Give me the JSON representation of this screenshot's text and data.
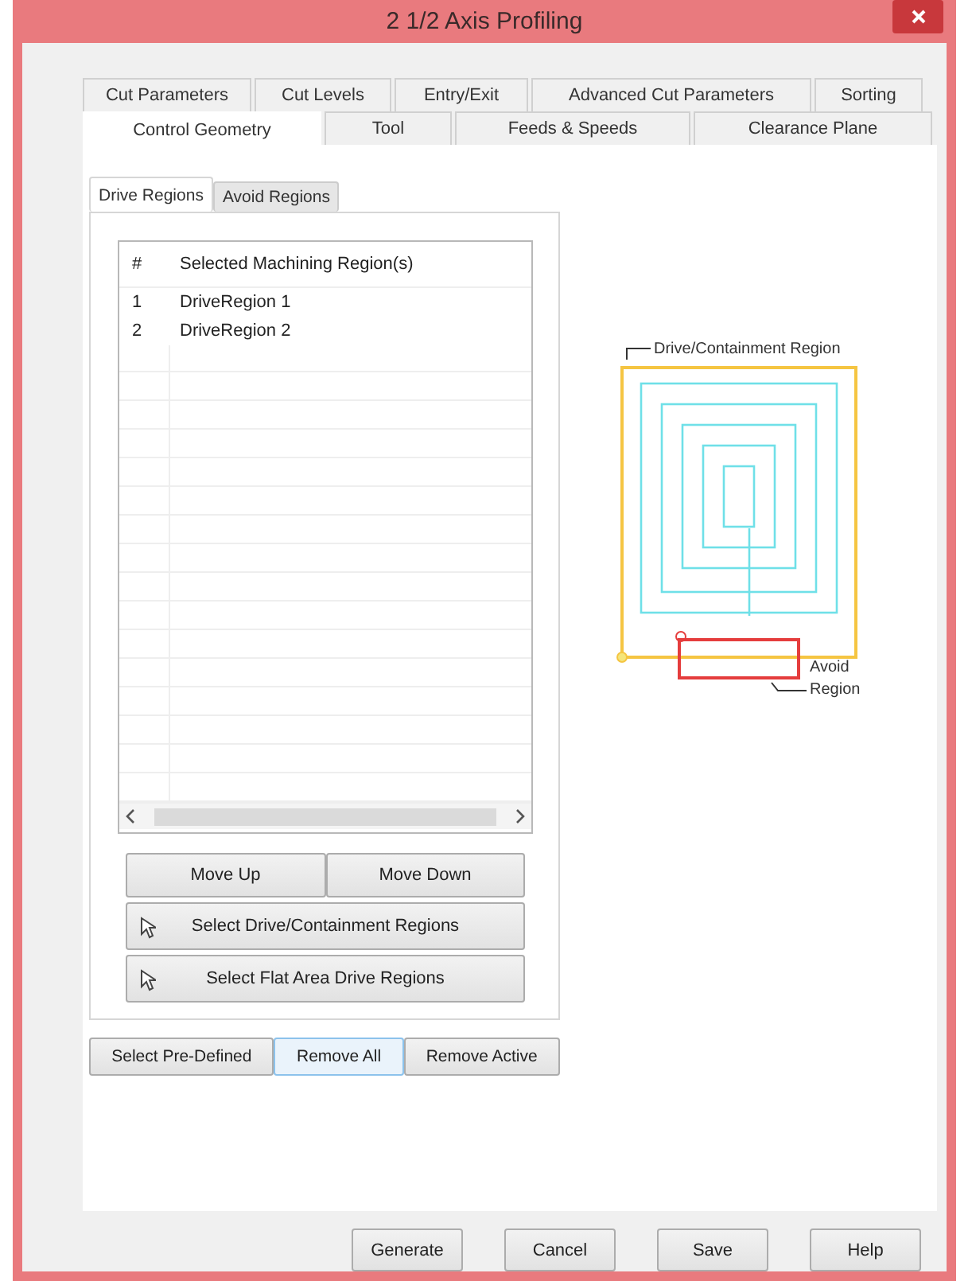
{
  "window": {
    "title": "2 1/2 Axis Profiling"
  },
  "tab_rows": [
    [
      {
        "label": "Cut Parameters",
        "selected": false
      },
      {
        "label": "Cut Levels",
        "selected": false
      },
      {
        "label": "Entry/Exit",
        "selected": false
      },
      {
        "label": "Advanced Cut Parameters",
        "selected": false
      },
      {
        "label": "Sorting",
        "selected": false
      }
    ],
    [
      {
        "label": "Control Geometry",
        "selected": true
      },
      {
        "label": "Tool",
        "selected": false
      },
      {
        "label": "Feeds & Speeds",
        "selected": false
      },
      {
        "label": "Clearance Plane",
        "selected": false
      }
    ]
  ],
  "region_tabs": [
    {
      "label": "Drive Regions",
      "selected": true
    },
    {
      "label": "Avoid Regions",
      "selected": false
    }
  ],
  "table": {
    "columns": [
      "#",
      "Selected Machining Region(s)"
    ],
    "rows": [
      [
        "1",
        "DriveRegion 1"
      ],
      [
        "2",
        "DriveRegion 2"
      ]
    ]
  },
  "move_buttons": [
    "Move Up",
    "Move Down"
  ],
  "select_buttons": [
    "Select Drive/Containment Regions",
    "Select Flat Area Drive Regions"
  ],
  "list_buttons": [
    {
      "label": "Select Pre-Defined",
      "focused": false
    },
    {
      "label": "Remove All",
      "focused": true
    },
    {
      "label": "Remove Active",
      "focused": false
    }
  ],
  "diagram": {
    "drive_label": "Drive/Containment Region",
    "avoid_label": "Avoid Region"
  },
  "footer_buttons": [
    "Generate",
    "Cancel",
    "Save",
    "Help"
  ]
}
